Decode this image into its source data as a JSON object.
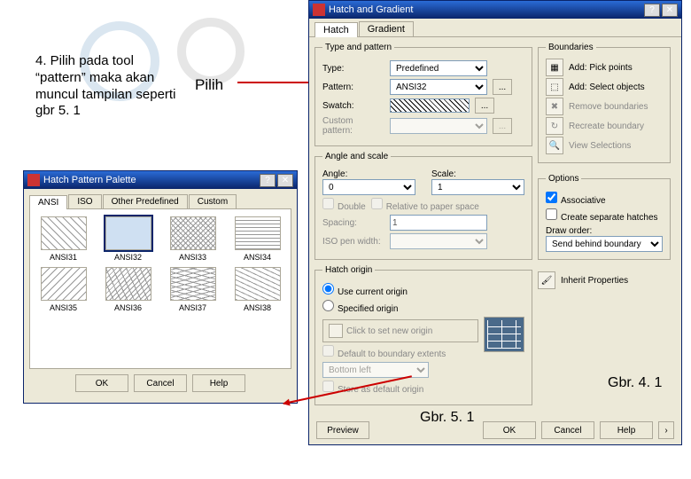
{
  "instruction": "4. Pilih pada tool “pattern” maka akan muncul tampilan seperti gbr 5. 1",
  "pilih_label": "Pilih",
  "caption1": "Gbr. 4. 1",
  "caption2": "Gbr. 5. 1",
  "hatch_dialog": {
    "title": "Hatch and Gradient",
    "tabs": {
      "hatch": "Hatch",
      "gradient": "Gradient"
    },
    "groups": {
      "type_and_pattern": "Type and pattern",
      "angle_and_scale": "Angle and scale",
      "hatch_origin": "Hatch origin",
      "boundaries": "Boundaries",
      "options": "Options"
    },
    "labels": {
      "type": "Type:",
      "pattern": "Pattern:",
      "swatch": "Swatch:",
      "custom_pattern": "Custom pattern:",
      "angle": "Angle:",
      "scale": "Scale:",
      "double": "Double",
      "rel_paper": "Relative to paper space",
      "spacing": "Spacing:",
      "iso_pen": "ISO pen width:",
      "use_current": "Use current origin",
      "specified": "Specified origin",
      "click_set": "Click to set new origin",
      "default_ext": "Default to boundary extents",
      "store_default": "Store as default origin",
      "add_pick": "Add: Pick points",
      "add_select": "Add: Select objects",
      "remove_b": "Remove boundaries",
      "recreate_b": "Recreate boundary",
      "view_sel": "View Selections",
      "associative": "Associative",
      "create_sep": "Create separate hatches",
      "draw_order": "Draw order:",
      "inherit": "Inherit Properties"
    },
    "values": {
      "type": "Predefined",
      "pattern": "ANSI32",
      "angle": "0",
      "scale": "1",
      "spacing": "1",
      "bottom_left": "Bottom left",
      "draw_order": "Send behind boundary"
    },
    "buttons": {
      "preview": "Preview",
      "ok": "OK",
      "cancel": "Cancel",
      "help": "Help",
      "dots": "..."
    }
  },
  "palette_dialog": {
    "title": "Hatch Pattern Palette",
    "tabs": {
      "ansi": "ANSI",
      "iso": "ISO",
      "other": "Other Predefined",
      "custom": "Custom"
    },
    "patterns": [
      {
        "name": "ANSI31"
      },
      {
        "name": "ANSI32"
      },
      {
        "name": "ANSI33"
      },
      {
        "name": "ANSI34"
      },
      {
        "name": "ANSI35"
      },
      {
        "name": "ANSI36"
      },
      {
        "name": "ANSI37"
      },
      {
        "name": "ANSI38"
      }
    ],
    "buttons": {
      "ok": "OK",
      "cancel": "Cancel",
      "help": "Help"
    }
  }
}
